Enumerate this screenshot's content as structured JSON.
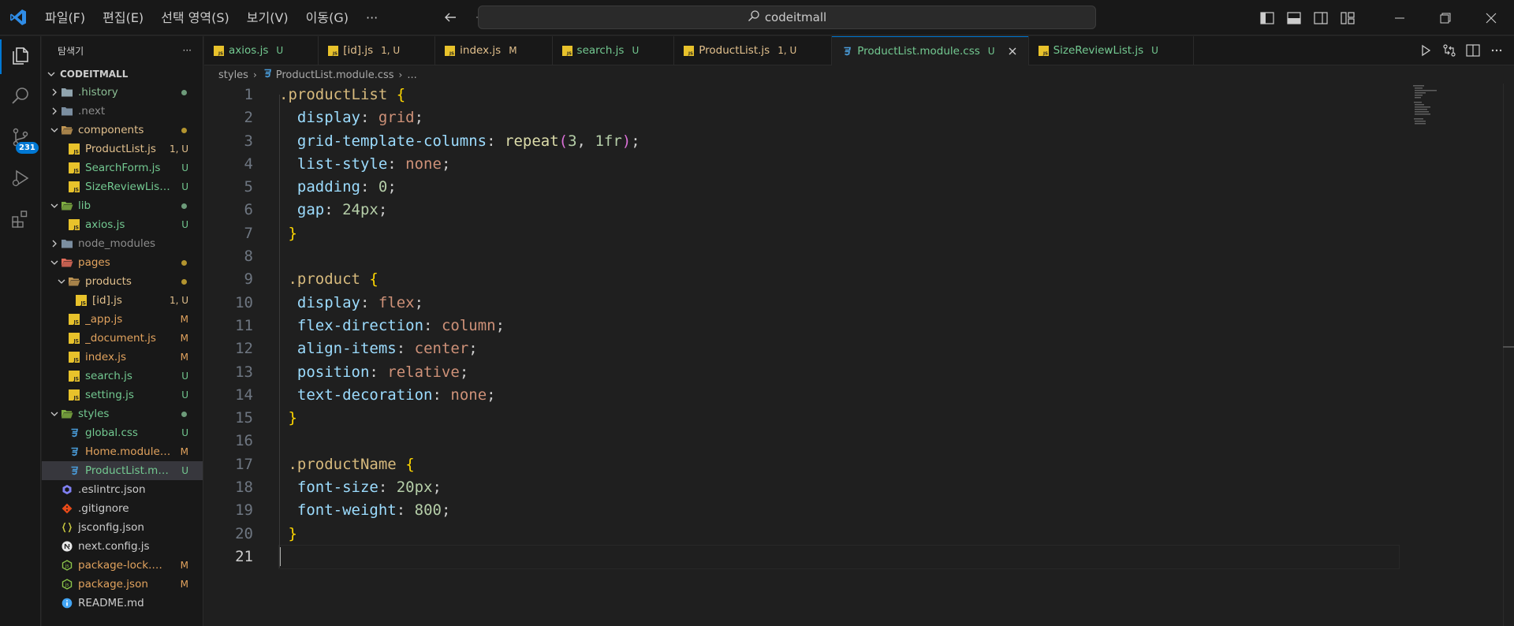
{
  "titlebar": {
    "menu": [
      "파일(F)",
      "편집(E)",
      "선택 영역(S)",
      "보기(V)",
      "이동(G)",
      "···"
    ],
    "search_text": "codeitmall"
  },
  "activity": {
    "source_control_badge": "231"
  },
  "explorer": {
    "title": "탐색기",
    "more": "···",
    "root": "CODEITMALL",
    "items": [
      {
        "label": ".history",
        "depth": 0,
        "kind": "folder",
        "open": false,
        "color": "gray-green",
        "status": "",
        "dot": "#6d9b7a"
      },
      {
        "label": ".next",
        "depth": 0,
        "kind": "folder",
        "open": false,
        "color": "gray",
        "status": "",
        "dot": ""
      },
      {
        "label": "components",
        "depth": 0,
        "kind": "folder",
        "open": true,
        "color": "yellow",
        "status": "",
        "dot": "#b3942f"
      },
      {
        "label": "ProductList.js",
        "depth": 1,
        "kind": "js",
        "color": "yellow",
        "status": "1, U"
      },
      {
        "label": "SearchForm.js",
        "depth": 1,
        "kind": "js",
        "color": "green",
        "status": "U"
      },
      {
        "label": "SizeReviewList.js",
        "depth": 1,
        "kind": "js",
        "color": "green",
        "status": "U"
      },
      {
        "label": "lib",
        "depth": 0,
        "kind": "folder",
        "open": true,
        "color": "green",
        "status": "",
        "dot": "#6d9b7a"
      },
      {
        "label": "axios.js",
        "depth": 1,
        "kind": "js",
        "color": "green",
        "status": "U"
      },
      {
        "label": "node_modules",
        "depth": 0,
        "kind": "folder",
        "open": false,
        "color": "gray",
        "status": "",
        "dot": ""
      },
      {
        "label": "pages",
        "depth": 0,
        "kind": "folder",
        "open": true,
        "color": "orange",
        "status": "",
        "dot": "#b3942f"
      },
      {
        "label": "products",
        "depth": 1,
        "kind": "folder",
        "open": true,
        "color": "yellow",
        "status": "",
        "dot": "#b3942f"
      },
      {
        "label": "[id].js",
        "depth": 2,
        "kind": "js",
        "color": "yellow",
        "status": "1, U"
      },
      {
        "label": "_app.js",
        "depth": 1,
        "kind": "js",
        "color": "orange",
        "status": "M"
      },
      {
        "label": "_document.js",
        "depth": 1,
        "kind": "js",
        "color": "orange",
        "status": "M"
      },
      {
        "label": "index.js",
        "depth": 1,
        "kind": "js",
        "color": "orange",
        "status": "M"
      },
      {
        "label": "search.js",
        "depth": 1,
        "kind": "js",
        "color": "green",
        "status": "U"
      },
      {
        "label": "setting.js",
        "depth": 1,
        "kind": "js",
        "color": "green",
        "status": "U"
      },
      {
        "label": "styles",
        "depth": 0,
        "kind": "folder",
        "open": true,
        "color": "green",
        "status": "",
        "dot": "#6d9b7a"
      },
      {
        "label": "global.css",
        "depth": 1,
        "kind": "css",
        "color": "green",
        "status": "U"
      },
      {
        "label": "Home.module....",
        "depth": 1,
        "kind": "css",
        "color": "orange",
        "status": "M"
      },
      {
        "label": "ProductList.mo...",
        "depth": 1,
        "kind": "css",
        "color": "green",
        "status": "U",
        "selected": true
      },
      {
        "label": ".eslintrc.json",
        "depth": 0,
        "kind": "eslint",
        "color": "white",
        "status": ""
      },
      {
        "label": ".gitignore",
        "depth": 0,
        "kind": "git",
        "color": "white",
        "status": ""
      },
      {
        "label": "jsconfig.json",
        "depth": 0,
        "kind": "json",
        "color": "white",
        "status": ""
      },
      {
        "label": "next.config.js",
        "depth": 0,
        "kind": "next",
        "color": "white",
        "status": ""
      },
      {
        "label": "package-lock.js...",
        "depth": 0,
        "kind": "npm",
        "color": "orange",
        "status": "M"
      },
      {
        "label": "package.json",
        "depth": 0,
        "kind": "npm",
        "color": "orange",
        "status": "M"
      },
      {
        "label": "README.md",
        "depth": 0,
        "kind": "info",
        "color": "white",
        "status": ""
      }
    ]
  },
  "tabs": [
    {
      "label": "axios.js",
      "status": "U",
      "kind": "js",
      "color": "#73c991"
    },
    {
      "label": "[id].js",
      "status": "1, U",
      "kind": "js",
      "color": "#e2c08d"
    },
    {
      "label": "index.js",
      "status": "M",
      "kind": "js",
      "color": "#e2c08d"
    },
    {
      "label": "search.js",
      "status": "U",
      "kind": "js",
      "color": "#73c991"
    },
    {
      "label": "ProductList.js",
      "status": "1, U",
      "kind": "js",
      "color": "#e2c08d"
    },
    {
      "label": "ProductList.module.css",
      "status": "U",
      "kind": "css",
      "color": "#73c991",
      "active": true
    },
    {
      "label": "SizeReviewList.js",
      "status": "U",
      "kind": "js",
      "color": "#73c991"
    }
  ],
  "breadcrumb": {
    "folder": "styles",
    "file": "ProductList.module.css",
    "tail": "..."
  },
  "editor": {
    "current_line": 21,
    "lines": [
      [
        {
          "t": ".productList",
          "c": "selector"
        },
        {
          "t": " ",
          "c": "punct"
        },
        {
          "t": "{",
          "c": "brace"
        }
      ],
      [
        {
          "t": "  ",
          "c": "punct"
        },
        {
          "t": "display",
          "c": "prop"
        },
        {
          "t": ": ",
          "c": "punct"
        },
        {
          "t": "grid",
          "c": "val"
        },
        {
          "t": ";",
          "c": "punct"
        }
      ],
      [
        {
          "t": "  ",
          "c": "punct"
        },
        {
          "t": "grid-template-columns",
          "c": "prop"
        },
        {
          "t": ": ",
          "c": "punct"
        },
        {
          "t": "repeat",
          "c": "fn"
        },
        {
          "t": "(",
          "c": "paren"
        },
        {
          "t": "3",
          "c": "num"
        },
        {
          "t": ", ",
          "c": "punct"
        },
        {
          "t": "1fr",
          "c": "num"
        },
        {
          "t": ")",
          "c": "paren"
        },
        {
          "t": ";",
          "c": "punct"
        }
      ],
      [
        {
          "t": "  ",
          "c": "punct"
        },
        {
          "t": "list-style",
          "c": "prop"
        },
        {
          "t": ": ",
          "c": "punct"
        },
        {
          "t": "none",
          "c": "val"
        },
        {
          "t": ";",
          "c": "punct"
        }
      ],
      [
        {
          "t": "  ",
          "c": "punct"
        },
        {
          "t": "padding",
          "c": "prop"
        },
        {
          "t": ": ",
          "c": "punct"
        },
        {
          "t": "0",
          "c": "num"
        },
        {
          "t": ";",
          "c": "punct"
        }
      ],
      [
        {
          "t": "  ",
          "c": "punct"
        },
        {
          "t": "gap",
          "c": "prop"
        },
        {
          "t": ": ",
          "c": "punct"
        },
        {
          "t": "24px",
          "c": "num"
        },
        {
          "t": ";",
          "c": "punct"
        }
      ],
      [
        {
          "t": " ",
          "c": "punct"
        },
        {
          "t": "}",
          "c": "brace"
        }
      ],
      [],
      [
        {
          "t": " ",
          "c": "punct"
        },
        {
          "t": ".product",
          "c": "selector"
        },
        {
          "t": " ",
          "c": "punct"
        },
        {
          "t": "{",
          "c": "brace"
        }
      ],
      [
        {
          "t": "  ",
          "c": "punct"
        },
        {
          "t": "display",
          "c": "prop"
        },
        {
          "t": ": ",
          "c": "punct"
        },
        {
          "t": "flex",
          "c": "val"
        },
        {
          "t": ";",
          "c": "punct"
        }
      ],
      [
        {
          "t": "  ",
          "c": "punct"
        },
        {
          "t": "flex-direction",
          "c": "prop"
        },
        {
          "t": ": ",
          "c": "punct"
        },
        {
          "t": "column",
          "c": "val"
        },
        {
          "t": ";",
          "c": "punct"
        }
      ],
      [
        {
          "t": "  ",
          "c": "punct"
        },
        {
          "t": "align-items",
          "c": "prop"
        },
        {
          "t": ": ",
          "c": "punct"
        },
        {
          "t": "center",
          "c": "val"
        },
        {
          "t": ";",
          "c": "punct"
        }
      ],
      [
        {
          "t": "  ",
          "c": "punct"
        },
        {
          "t": "position",
          "c": "prop"
        },
        {
          "t": ": ",
          "c": "punct"
        },
        {
          "t": "relative",
          "c": "val"
        },
        {
          "t": ";",
          "c": "punct"
        }
      ],
      [
        {
          "t": "  ",
          "c": "punct"
        },
        {
          "t": "text-decoration",
          "c": "prop"
        },
        {
          "t": ": ",
          "c": "punct"
        },
        {
          "t": "none",
          "c": "val"
        },
        {
          "t": ";",
          "c": "punct"
        }
      ],
      [
        {
          "t": " ",
          "c": "punct"
        },
        {
          "t": "}",
          "c": "brace"
        }
      ],
      [],
      [
        {
          "t": " ",
          "c": "punct"
        },
        {
          "t": ".productName",
          "c": "selector"
        },
        {
          "t": " ",
          "c": "punct"
        },
        {
          "t": "{",
          "c": "brace"
        }
      ],
      [
        {
          "t": "  ",
          "c": "punct"
        },
        {
          "t": "font-size",
          "c": "prop"
        },
        {
          "t": ": ",
          "c": "punct"
        },
        {
          "t": "20px",
          "c": "num"
        },
        {
          "t": ";",
          "c": "punct"
        }
      ],
      [
        {
          "t": "  ",
          "c": "punct"
        },
        {
          "t": "font-weight",
          "c": "prop"
        },
        {
          "t": ": ",
          "c": "punct"
        },
        {
          "t": "800",
          "c": "num"
        },
        {
          "t": ";",
          "c": "punct"
        }
      ],
      [
        {
          "t": " ",
          "c": "punct"
        },
        {
          "t": "}",
          "c": "brace"
        }
      ],
      []
    ]
  }
}
